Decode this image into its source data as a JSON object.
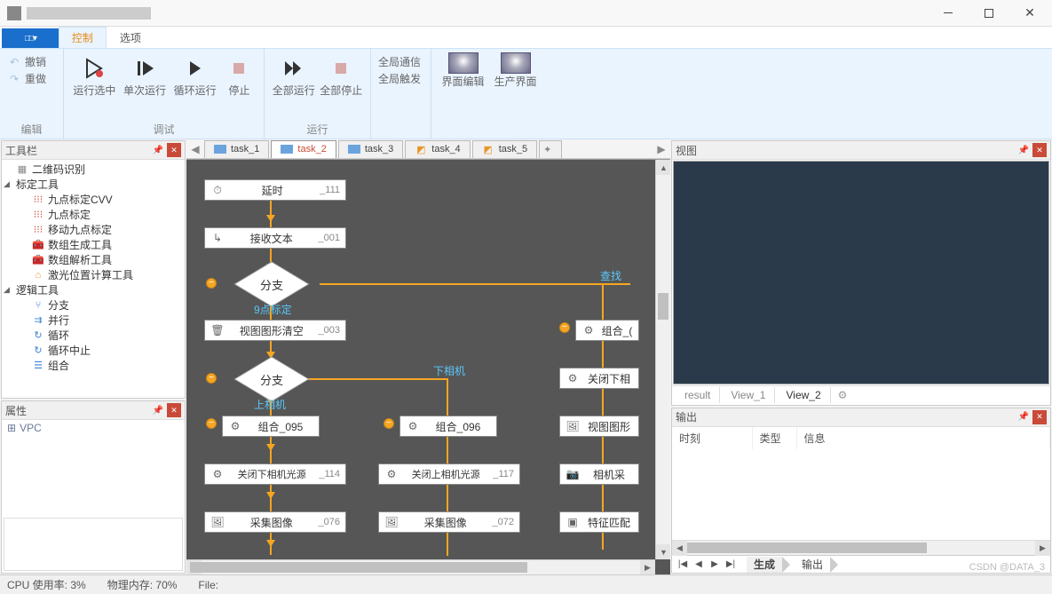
{
  "titlebar": {},
  "tabs": {
    "app_icon": "□□ ▾",
    "active": "控制",
    "t1": "控制",
    "t2": "选项"
  },
  "ribbon": {
    "edit": {
      "undo": "撤销",
      "redo": "重做",
      "label": "编辑"
    },
    "debug": {
      "run_sel": "运行选中",
      "step": "单次运行",
      "loop": "循环运行",
      "stop": "停止",
      "label": "调试"
    },
    "run": {
      "run_all": "全部运行",
      "stop_all": "全部停止",
      "label": "运行"
    },
    "global": {
      "comm": "全局通信",
      "trigger": "全局触发"
    },
    "ui": {
      "ui_edit": "界面编辑",
      "prod_ui": "生产界面"
    }
  },
  "panes": {
    "toolbox": {
      "title": "工具栏"
    },
    "attr": {
      "title": "属性",
      "vpc": "VPC"
    },
    "view": {
      "title": "视图"
    },
    "output": {
      "title": "输出"
    }
  },
  "tree": {
    "qrcode": "二维码识别",
    "calib": "标定工具",
    "calib_children": {
      "ninepoint_cvv": "九点标定CVV",
      "ninepoint": "九点标定",
      "move_nine": "移动九点标定",
      "arr_gen": "数组生成工具",
      "arr_parse": "数组解析工具",
      "laser_pos": "激光位置计算工具"
    },
    "logic": "逻辑工具",
    "logic_children": {
      "branch": "分支",
      "parallel": "并行",
      "loop": "循环",
      "loop_break": "循环中止",
      "combine": "组合"
    }
  },
  "doctabs": {
    "t1": "task_1",
    "t2": "task_2",
    "t3": "task_3",
    "t4": "task_4",
    "t5": "task_5"
  },
  "flow": {
    "delay": "延时",
    "delay_id": "_111",
    "recv": "接收文本",
    "recv_id": "_001",
    "branch": "分支",
    "label_find": "查找",
    "label_ninepoint": "9点标定",
    "view_clear": "视图图形清空",
    "view_clear_id": "_003",
    "comb": "组合_(",
    "label_lower": "下相机",
    "close_lower": "关闭下相",
    "label_upper": "上相机",
    "comb95": "组合_095",
    "comb96": "组合_096",
    "view_shape": "视图图形",
    "close_lower_light": "关闭下相机光源",
    "close_lower_light_id": "_114",
    "close_upper_light": "关闭上相机光源",
    "close_upper_light_id": "_117",
    "cam_capture": "相机采",
    "capture_img": "采集图像",
    "capture_id1": "_076",
    "capture_id2": "_072",
    "feature": "特征匹配"
  },
  "viewtabs": {
    "result": "result",
    "v1": "View_1",
    "v2": "View_2"
  },
  "output_cols": {
    "time": "时刻",
    "type": "类型",
    "info": "信息"
  },
  "bottomtabs": {
    "gen": "生成",
    "out": "输出"
  },
  "status": {
    "cpu_label": "CPU 使用率:",
    "cpu_val": "3%",
    "mem_label": "物理内存:",
    "mem_val": "70%",
    "file_label": "File:"
  },
  "watermark": "CSDN @DATA_3"
}
